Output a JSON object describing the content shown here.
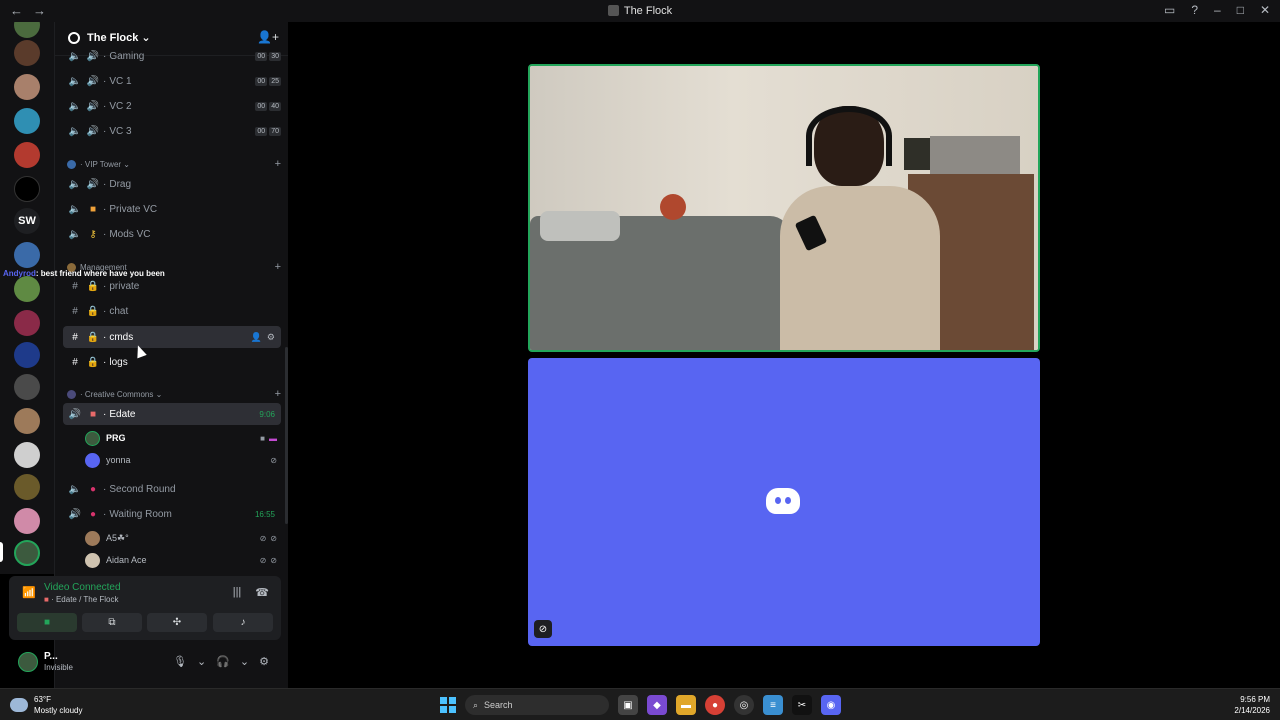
{
  "window": {
    "title": "The Flock"
  },
  "server": {
    "name": "The Flock",
    "chevron": "⌄"
  },
  "categories": {
    "vip_tower": "VIP Tower",
    "management": "Management",
    "creative_commons": "Creative Commons"
  },
  "channels": [
    {
      "name": "Gaming",
      "counts": [
        "00",
        "30"
      ]
    },
    {
      "name": "VC 1",
      "counts": [
        "00",
        "25"
      ]
    },
    {
      "name": "VC 2",
      "counts": [
        "00",
        "40"
      ]
    },
    {
      "name": "VC 3",
      "counts": [
        "00",
        "70"
      ]
    },
    {
      "name": "Drag"
    },
    {
      "name": "Private VC"
    },
    {
      "name": "Mods VC"
    },
    {
      "name": "private"
    },
    {
      "name": "chat"
    },
    {
      "name": "cmds"
    },
    {
      "name": "logs"
    },
    {
      "name": "Edate",
      "timer": "9:06"
    },
    {
      "name": "Second Round"
    },
    {
      "name": "Waiting Room",
      "timer": "16:55"
    }
  ],
  "members": {
    "edate": [
      {
        "name": "PRG"
      },
      {
        "name": "yonna"
      }
    ],
    "waiting_room": [
      {
        "name": "A5☘︎°"
      },
      {
        "name": "Aidan Ace"
      }
    ]
  },
  "overlay": {
    "user": "Andyrod",
    "message": ": best friend where have you been"
  },
  "voice": {
    "status": "Video Connected",
    "location": "Edate / The Flock"
  },
  "user": {
    "name": "P...",
    "status": "Invisible"
  },
  "guild_list": {
    "sw_label": "SW"
  },
  "taskbar": {
    "weather_temp": "63°F",
    "weather_desc": "Mostly cloudy",
    "search_placeholder": "Search",
    "time": "9:56 PM",
    "date": "2/14/2026"
  },
  "colors": {
    "green": "#23a55a",
    "blurple": "#5865f2",
    "sidebar": "#121214"
  }
}
